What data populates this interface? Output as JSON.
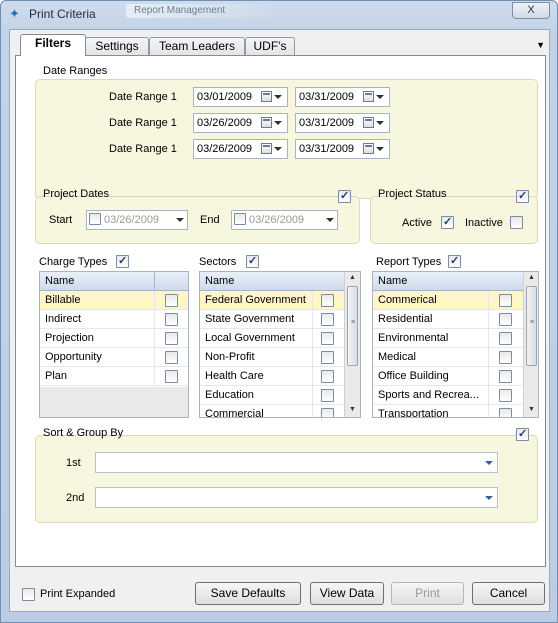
{
  "window": {
    "title": "Print Criteria",
    "ghost_title": "Report Management",
    "close_symbol": "X"
  },
  "tabs": [
    {
      "label": "Filters",
      "active": true
    },
    {
      "label": "Settings"
    },
    {
      "label": "Team Leaders"
    },
    {
      "label": "UDF's"
    }
  ],
  "date_ranges": {
    "title": "Date Ranges",
    "rows": [
      {
        "label": "Date Range 1",
        "from": "03/01/2009",
        "to": "03/31/2009"
      },
      {
        "label": "Date Range 1",
        "from": "03/26/2009",
        "to": "03/31/2009"
      },
      {
        "label": "Date Range 1",
        "from": "03/26/2009",
        "to": "03/31/2009"
      }
    ]
  },
  "project_dates": {
    "title": "Project Dates",
    "checked": true,
    "start_label": "Start",
    "start_value": "03/26/2009",
    "end_label": "End",
    "end_value": "03/26/2009"
  },
  "project_status": {
    "title": "Project Status",
    "checked": true,
    "active_label": "Active",
    "active_checked": true,
    "inactive_label": "Inactive",
    "inactive_checked": false
  },
  "charge_types": {
    "title": "Charge Types",
    "checked": true,
    "header": "Name",
    "items": [
      "Billable",
      "Indirect",
      "Projection",
      "Opportunity",
      "Plan"
    ]
  },
  "sectors": {
    "title": "Sectors",
    "checked": true,
    "header": "Name",
    "items": [
      "Federal Government",
      "State Government",
      "Local Government",
      "Non-Profit",
      "Health Care",
      "Education",
      "Commercial"
    ]
  },
  "report_types": {
    "title": "Report Types",
    "checked": true,
    "header": "Name",
    "items": [
      "Commerical",
      "Residential",
      "Environmental",
      "Medical",
      "Office Building",
      "Sports and Recrea...",
      "Transportation"
    ]
  },
  "sort_group": {
    "title": "Sort & Group By",
    "checked": true,
    "first_label": "1st",
    "first_value": "",
    "second_label": "2nd",
    "second_value": ""
  },
  "footer": {
    "print_expanded_label": "Print Expanded",
    "print_expanded_checked": false,
    "save_defaults": "Save Defaults",
    "view_data": "View Data",
    "print": "Print",
    "cancel": "Cancel"
  }
}
